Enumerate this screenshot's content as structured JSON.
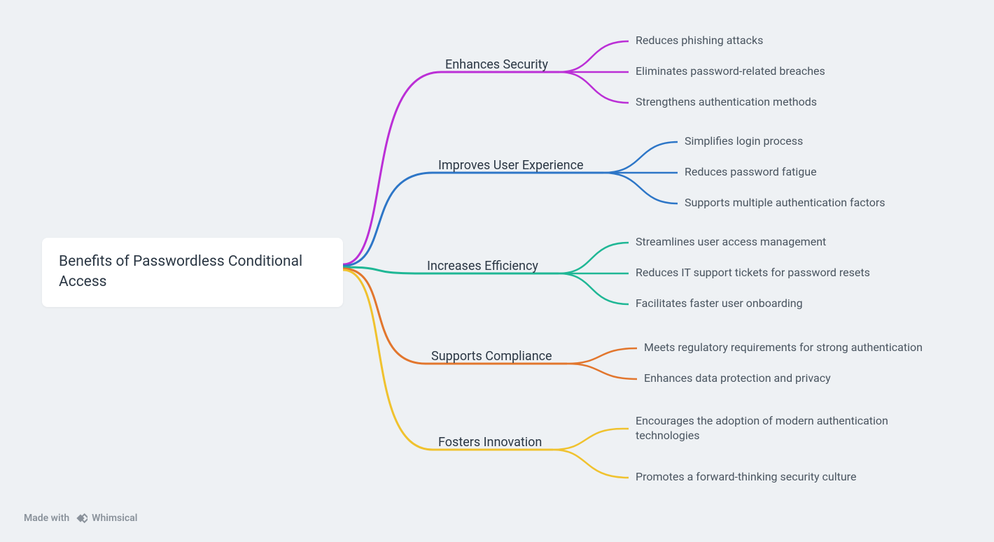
{
  "root": {
    "title": "Benefits of Passwordless Conditional Access"
  },
  "branches": [
    {
      "label": "Enhances Security",
      "color": "#bb2fd6",
      "children": [
        "Reduces phishing attacks",
        "Eliminates password-related breaches",
        "Strengthens authentication methods"
      ]
    },
    {
      "label": "Improves User Experience",
      "color": "#2d76c7",
      "children": [
        "Simplifies login process",
        "Reduces password fatigue",
        "Supports multiple authentication factors"
      ]
    },
    {
      "label": "Increases Efficiency",
      "color": "#1fb795",
      "children": [
        "Streamlines user access management",
        "Reduces IT support tickets for password resets",
        "Facilitates faster user onboarding"
      ]
    },
    {
      "label": "Supports Compliance",
      "color": "#e2762d",
      "children": [
        "Meets regulatory requirements for strong authentication",
        "Enhances data protection and privacy"
      ]
    },
    {
      "label": "Fosters Innovation",
      "color": "#f0c22e",
      "children": [
        "Encourages the adoption of modern authentication technologies",
        "Promotes a forward-thinking security culture"
      ]
    }
  ],
  "footer": {
    "made_with": "Made with",
    "brand": "Whimsical"
  }
}
